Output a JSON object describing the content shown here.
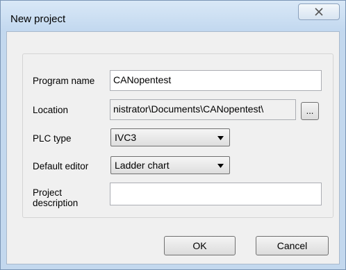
{
  "window": {
    "title": "New project",
    "close_icon": "close-icon"
  },
  "form": {
    "program_name": {
      "label": "Program name",
      "value": "CANopentest"
    },
    "location": {
      "label": "Location",
      "value": "nistrator\\Documents\\CANopentest\\",
      "browse_label": "..."
    },
    "plc_type": {
      "label": "PLC type",
      "value": "IVC3",
      "icon": "chevron-down-icon"
    },
    "default_editor": {
      "label": "Default editor",
      "value": "Ladder chart",
      "icon": "chevron-down-icon"
    },
    "description": {
      "label": "Project description",
      "value": ""
    }
  },
  "buttons": {
    "ok_label": "OK",
    "cancel_label": "Cancel"
  },
  "colors": {
    "title_bar": "#c2d8ef",
    "client_background": "#f0f0f0"
  }
}
